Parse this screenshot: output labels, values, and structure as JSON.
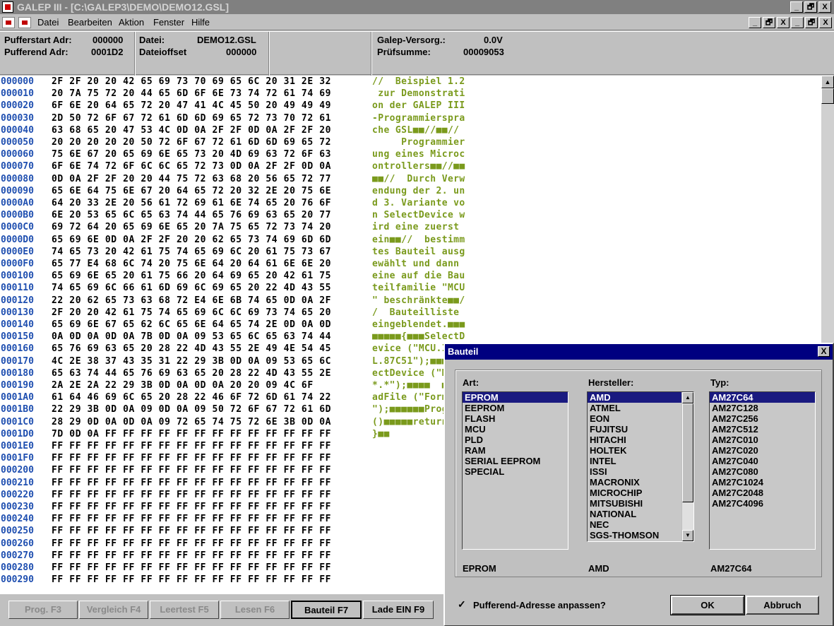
{
  "window": {
    "title": "GALEP III - [C:\\GALEP3\\DEMO\\DEMO12.GSL]",
    "btn_min": "_",
    "btn_restore": "🗗",
    "btn_close": "X"
  },
  "menu": [
    "Datei",
    "Bearbeiten",
    "Aktion",
    "Fenster",
    "Hilfe"
  ],
  "info": {
    "pufferstart_label": "Pufferstart Adr:",
    "pufferstart_value": "000000",
    "pufferend_label": "Pufferend Adr:",
    "pufferend_value": "0001D2",
    "datei_label": "Datei:",
    "datei_value": "DEMO12.GSL",
    "dateioffset_label": "Dateioffset",
    "dateioffset_value": "000000",
    "versorg_label": "Galep-Versorg.:",
    "versorg_value": "0.0V",
    "pruefsumme_label": "Prüfsumme:",
    "pruefsumme_value": "00009053"
  },
  "hex_rows": [
    {
      "addr": "000000",
      "bytes": "2F 2F 20 20 42 65 69 73 70 69 65 6C 20 31 2E 32",
      "ascii": "//  Beispiel 1.2"
    },
    {
      "addr": "000010",
      "bytes": "20 7A 75 72 20 44 65 6D 6F 6E 73 74 72 61 74 69",
      "ascii": " zur Demonstrati"
    },
    {
      "addr": "000020",
      "bytes": "6F 6E 20 64 65 72 20 47 41 4C 45 50 20 49 49 49",
      "ascii": "on der GALEP III"
    },
    {
      "addr": "000030",
      "bytes": "2D 50 72 6F 67 72 61 6D 6D 69 65 72 73 70 72 61",
      "ascii": "-Programmierspra"
    },
    {
      "addr": "000040",
      "bytes": "63 68 65 20 47 53 4C 0D 0A 2F 2F 0D 0A 2F 2F 20",
      "ascii": "che GSL■■//■■// "
    },
    {
      "addr": "000050",
      "bytes": "20 20 20 20 20 50 72 6F 67 72 61 6D 6D 69 65 72",
      "ascii": "     Programmier"
    },
    {
      "addr": "000060",
      "bytes": "75 6E 67 20 65 69 6E 65 73 20 4D 69 63 72 6F 63",
      "ascii": "ung eines Microc"
    },
    {
      "addr": "000070",
      "bytes": "6F 6E 74 72 6F 6C 6C 65 72 73 0D 0A 2F 2F 0D 0A",
      "ascii": "ontrollers■■//■■"
    },
    {
      "addr": "000080",
      "bytes": "0D 0A 2F 2F 20 20 44 75 72 63 68 20 56 65 72 77",
      "ascii": "■■//  Durch Verw"
    },
    {
      "addr": "000090",
      "bytes": "65 6E 64 75 6E 67 20 64 65 72 20 32 2E 20 75 6E",
      "ascii": "endung der 2. un"
    },
    {
      "addr": "0000A0",
      "bytes": "64 20 33 2E 20 56 61 72 69 61 6E 74 65 20 76 6F",
      "ascii": "d 3. Variante vo"
    },
    {
      "addr": "0000B0",
      "bytes": "6E 20 53 65 6C 65 63 74 44 65 76 69 63 65 20 77",
      "ascii": "n SelectDevice w"
    },
    {
      "addr": "0000C0",
      "bytes": "69 72 64 20 65 69 6E 65 20 7A 75 65 72 73 74 20",
      "ascii": "ird eine zuerst "
    },
    {
      "addr": "0000D0",
      "bytes": "65 69 6E 0D 0A 2F 2F 20 20 62 65 73 74 69 6D 6D",
      "ascii": "ein■■//  bestimm"
    },
    {
      "addr": "0000E0",
      "bytes": "74 65 73 20 42 61 75 74 65 69 6C 20 61 75 73 67",
      "ascii": "tes Bauteil ausg"
    },
    {
      "addr": "0000F0",
      "bytes": "65 77 E4 68 6C 74 20 75 6E 64 20 64 61 6E 6E 20",
      "ascii": "ewählt und dann "
    },
    {
      "addr": "000100",
      "bytes": "65 69 6E 65 20 61 75 66 20 64 69 65 20 42 61 75",
      "ascii": "eine auf die Bau"
    },
    {
      "addr": "000110",
      "bytes": "74 65 69 6C 66 61 6D 69 6C 69 65 20 22 4D 43 55",
      "ascii": "teilfamilie \"MCU"
    },
    {
      "addr": "000120",
      "bytes": "22 20 62 65 73 63 68 72 E4 6E 6B 74 65 0D 0A 2F",
      "ascii": "\" beschränkte■■/"
    },
    {
      "addr": "000130",
      "bytes": "2F 20 20 42 61 75 74 65 69 6C 6C 69 73 74 65 20",
      "ascii": "/  Bauteilliste "
    },
    {
      "addr": "000140",
      "bytes": "65 69 6E 67 65 62 6C 65 6E 64 65 74 2E 0D 0A 0D",
      "ascii": "eingeblendet.■■■"
    },
    {
      "addr": "000150",
      "bytes": "0A 0D 0A 0D 0A 7B 0D 0A 09 53 65 6C 65 63 74 44",
      "ascii": "■■■■■{■■■SelectD"
    },
    {
      "addr": "000160",
      "bytes": "65 76 69 63 65 20 28 22 4D 43 55 2E 49 4E 54 45",
      "ascii": "evice (\"MCU.INTE"
    },
    {
      "addr": "000170",
      "bytes": "4C 2E 38 37 43 35 31 22 29 3B 0D 0A 09 53 65 6C",
      "ascii": "L.87C51\");■■■Sel"
    },
    {
      "addr": "000180",
      "bytes": "65 63 74 44 65 76 69 63 65 20 28 22 4D 43 55 2E",
      "ascii": "ectDevice (\"MCU."
    },
    {
      "addr": "000190",
      "bytes": "2A 2E 2A 22 29 3B 0D 0A 0D 0A 20 20 09 4C 6F",
      "ascii": "*.*\");■■■■  ■Lo"
    },
    {
      "addr": "0001A0",
      "bytes": "61 64 46 69 6C 65 20 28 22 46 6F 72 6D 61 74 22",
      "ascii": "adFile (\"Format\""
    },
    {
      "addr": "0001B0",
      "bytes": "22 29 3B 0D 0A 09 0D 0A 09 50 72 6F 67 72 61 6D",
      "ascii": "\");■■■■■■Program"
    },
    {
      "addr": "0001C0",
      "bytes": "28 29 0D 0A 0D 0A 09 72 65 74 75 72 6E 3B 0D 0A",
      "ascii": "()■■■■■return;■■"
    },
    {
      "addr": "0001D0",
      "bytes": "7D 0D 0A FF FF FF FF FF FF FF FF FF FF FF FF FF",
      "ascii": "}■■"
    },
    {
      "addr": "0001E0",
      "bytes": "FF FF FF FF FF FF FF FF FF FF FF FF FF FF FF FF",
      "ascii": ""
    },
    {
      "addr": "0001F0",
      "bytes": "FF FF FF FF FF FF FF FF FF FF FF FF FF FF FF FF",
      "ascii": ""
    },
    {
      "addr": "000200",
      "bytes": "FF FF FF FF FF FF FF FF FF FF FF FF FF FF FF FF",
      "ascii": ""
    },
    {
      "addr": "000210",
      "bytes": "FF FF FF FF FF FF FF FF FF FF FF FF FF FF FF FF",
      "ascii": ""
    },
    {
      "addr": "000220",
      "bytes": "FF FF FF FF FF FF FF FF FF FF FF FF FF FF FF FF",
      "ascii": ""
    },
    {
      "addr": "000230",
      "bytes": "FF FF FF FF FF FF FF FF FF FF FF FF FF FF FF FF",
      "ascii": ""
    },
    {
      "addr": "000240",
      "bytes": "FF FF FF FF FF FF FF FF FF FF FF FF FF FF FF FF",
      "ascii": ""
    },
    {
      "addr": "000250",
      "bytes": "FF FF FF FF FF FF FF FF FF FF FF FF FF FF FF FF",
      "ascii": ""
    },
    {
      "addr": "000260",
      "bytes": "FF FF FF FF FF FF FF FF FF FF FF FF FF FF FF FF",
      "ascii": ""
    },
    {
      "addr": "000270",
      "bytes": "FF FF FF FF FF FF FF FF FF FF FF FF FF FF FF FF",
      "ascii": ""
    },
    {
      "addr": "000280",
      "bytes": "FF FF FF FF FF FF FF FF FF FF FF FF FF FF FF FF",
      "ascii": ""
    },
    {
      "addr": "000290",
      "bytes": "FF FF FF FF FF FF FF FF FF FF FF FF FF FF FF FF",
      "ascii": ""
    }
  ],
  "fkeys": [
    {
      "label": "Prog. F3",
      "enabled": false,
      "active": false
    },
    {
      "label": "Vergleich F4",
      "enabled": false,
      "active": false
    },
    {
      "label": "Leertest F5",
      "enabled": false,
      "active": false
    },
    {
      "label": "Lesen F6",
      "enabled": false,
      "active": false
    },
    {
      "label": "Bauteil F7",
      "enabled": true,
      "active": true
    },
    {
      "label": "Lade EIN F9",
      "enabled": true,
      "active": false
    }
  ],
  "dialog": {
    "title": "Bauteil",
    "close": "X",
    "art_label": "Art:",
    "hersteller_label": "Hersteller:",
    "typ_label": "Typ:",
    "art_items": [
      "EPROM",
      "EEPROM",
      "FLASH",
      "MCU",
      "PLD",
      "RAM",
      "SERIAL EEPROM",
      "SPECIAL"
    ],
    "art_selected": 0,
    "hersteller_items": [
      "AMD",
      "ATMEL",
      "EON",
      "FUJITSU",
      "HITACHI",
      "HOLTEK",
      "INTEL",
      "ISSI",
      "MACRONIX",
      "MICROCHIP",
      "MITSUBISHI",
      "NATIONAL",
      "NEC",
      "SGS-THOMSON"
    ],
    "hersteller_selected": 0,
    "typ_items": [
      "AM27C64",
      "AM27C128",
      "AM27C256",
      "AM27C512",
      "AM27C010",
      "AM27C020",
      "AM27C040",
      "AM27C080",
      "AM27C1024",
      "AM27C2048",
      "AM27C4096"
    ],
    "typ_selected": 0,
    "art_value": "EPROM",
    "hersteller_value": "AMD",
    "typ_value": "AM27C64",
    "checkbox_checked": true,
    "checkbox_mark": "✓",
    "checkbox_label": "Pufferend-Adresse anpassen?",
    "ok_label": "OK",
    "cancel_label": "Abbruch"
  }
}
